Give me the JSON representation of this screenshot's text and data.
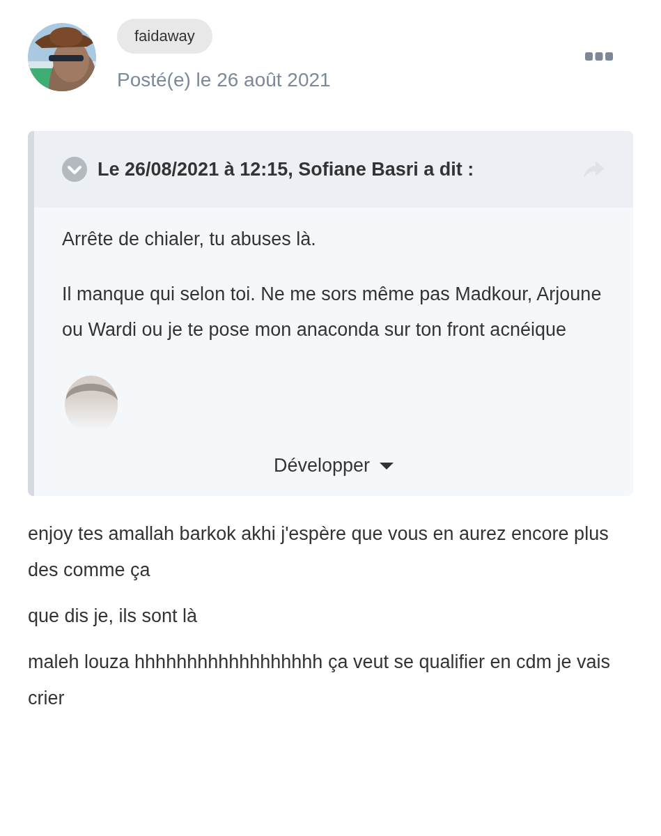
{
  "author": {
    "name": "faidaway",
    "posted": "Posté(e) le 26 août 2021"
  },
  "quote": {
    "header": "Le 26/08/2021 à 12:15, Sofiane Basri a dit :",
    "paragraphs": [
      "Arrête de chialer, tu abuses là.",
      "Il manque qui selon toi. Ne me sors même pas Madkour, Arjoune ou Wardi ou je te pose mon anaconda sur ton front acnéique"
    ],
    "image": {
      "kind": "picture"
    },
    "expand": "Développer"
  },
  "paragraphs": [
    "enjoy tes amallah barkok akhi j'espère que vous en aurez encore plus des comme ça",
    "que dis je, ils sont là",
    "maleh louza hhhhhhhhhhhhhhhhhh ça veut se qualifier en cdm je vais crier"
  ]
}
